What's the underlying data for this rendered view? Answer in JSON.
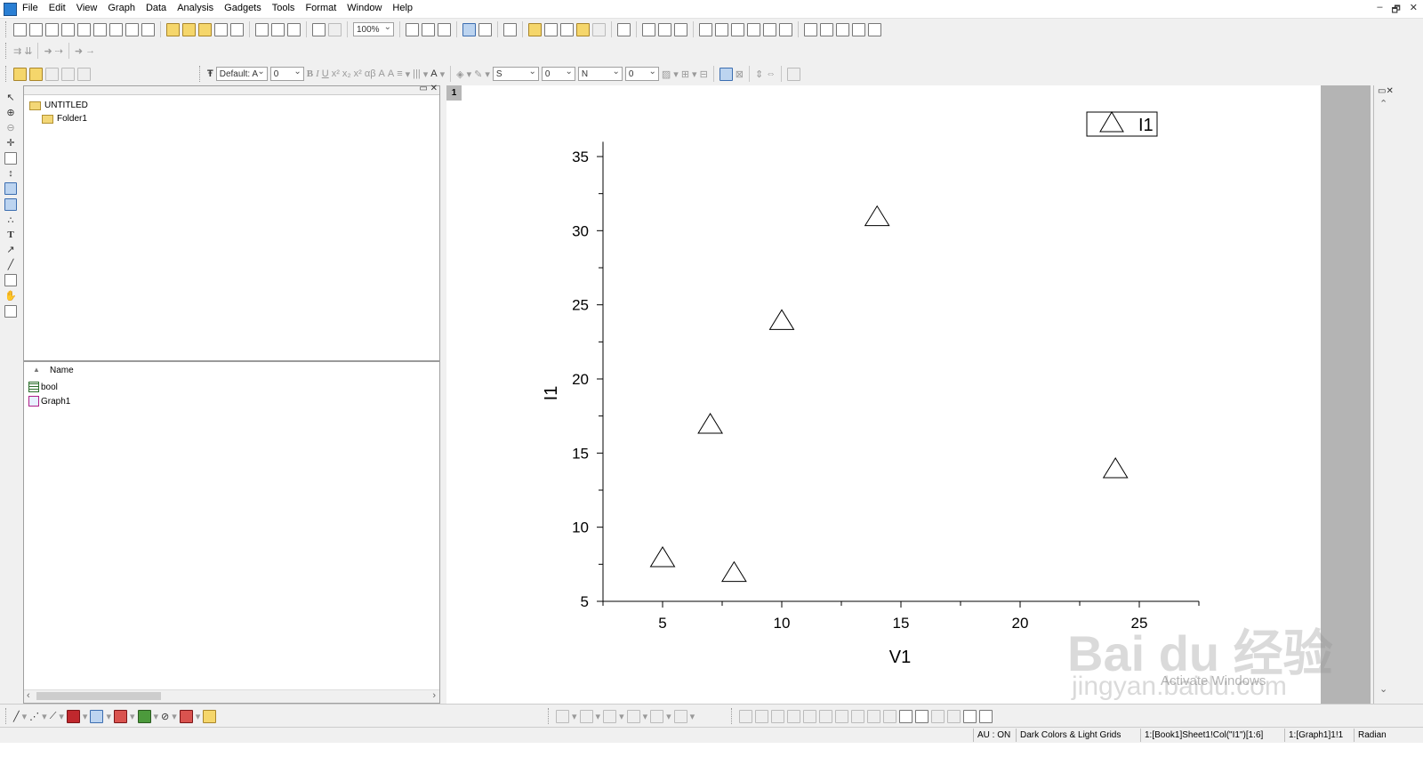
{
  "menubar": {
    "items": [
      "File",
      "Edit",
      "View",
      "Graph",
      "Data",
      "Analysis",
      "Gadgets",
      "Tools",
      "Format",
      "Window",
      "Help"
    ],
    "window_controls": [
      "‒",
      "🗗",
      "✕"
    ]
  },
  "toolbar": {
    "zoom_value": "100%",
    "font_name": "Default: A",
    "font_size": "0",
    "line_style": "S",
    "line_width": "0",
    "fill_style": "N",
    "fill_width": "0"
  },
  "explorer": {
    "root": "UNTITLED",
    "folder": "Folder1",
    "list_header": "Name",
    "items": [
      {
        "name": "bool",
        "icon": "workbook-icon"
      },
      {
        "name": "Graph1",
        "icon": "graph-icon"
      }
    ]
  },
  "graph": {
    "layer_number": "1"
  },
  "chart_data": {
    "type": "scatter",
    "marker": "open-triangle",
    "xlabel": "V1",
    "ylabel": "I1",
    "xlim": [
      2.5,
      27.5
    ],
    "ylim": [
      5,
      36
    ],
    "xticks": [
      5,
      10,
      15,
      20,
      25
    ],
    "yticks": [
      5,
      10,
      15,
      20,
      25,
      30,
      35
    ],
    "grid": false,
    "legend_position": "top-right",
    "series": [
      {
        "name": "I1",
        "x": [
          5,
          7,
          8,
          10,
          14,
          24
        ],
        "y": [
          8,
          17,
          7,
          24,
          31,
          14
        ]
      }
    ]
  },
  "statusbar": {
    "au": "AU : ON",
    "theme": "Dark Colors & Light Grids",
    "active_col": "1:[Book1]Sheet1!Col(\"I1\")[1:6]",
    "active_graph": "1:[Graph1]1!1",
    "angle_unit": "Radian"
  },
  "watermark": {
    "brand": "Bai du 经验",
    "site": "jingyan.baidu.com",
    "activate": "Activate Windows"
  }
}
